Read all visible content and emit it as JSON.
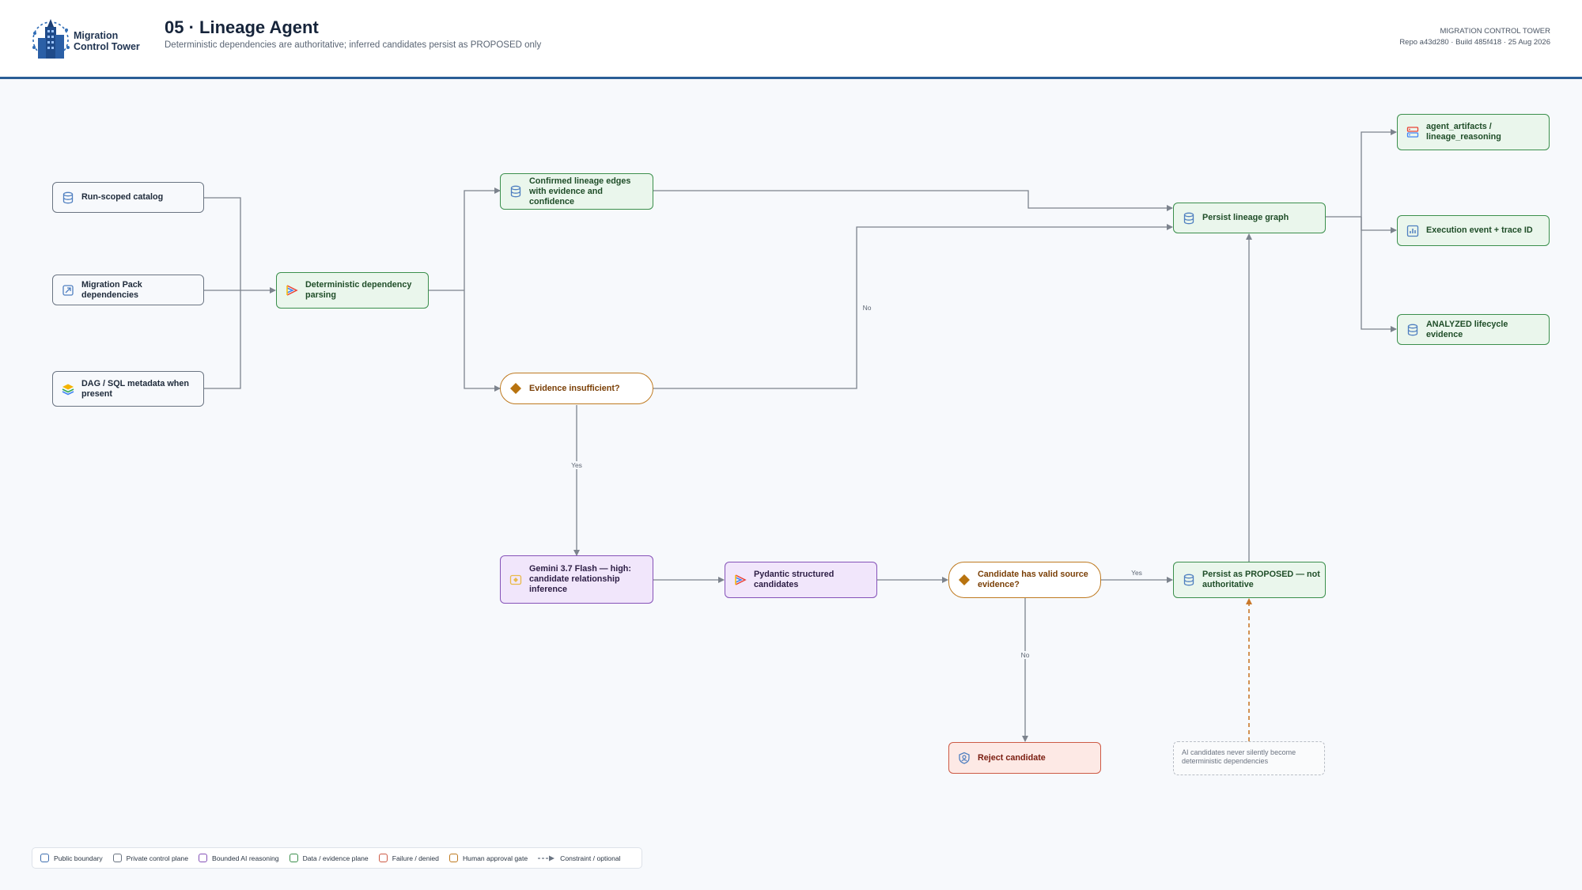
{
  "header": {
    "brand_line1": "Migration",
    "brand_line2": "Control Tower",
    "title": "05 · Lineage Agent",
    "subtitle": "Deterministic dependencies are authoritative; inferred candidates persist as PROPOSED only",
    "tower_label": "MIGRATION CONTROL TOWER",
    "build_meta": "Repo a43d280 · Build 485f418 · 25 Aug 2026"
  },
  "nodes": {
    "run_catalog": "Run-scoped catalog",
    "pack_deps": "Migration Pack dependencies",
    "dag_sql": "DAG / SQL metadata when present",
    "det_parsing": "Deterministic dependency parsing",
    "confirmed_edges": "Confirmed lineage edges with evidence and confidence",
    "evidence_insufficient": "Evidence insufficient?",
    "gemini": "Gemini 3.7 Flash — high: candidate relationship inference",
    "pydantic": "Pydantic structured candidates",
    "valid_source": "Candidate has valid source evidence?",
    "persist_proposed": "Persist as PROPOSED — not authoritative",
    "reject": "Reject candidate",
    "persist_graph": "Persist lineage graph",
    "artifacts": "agent_artifacts / lineage_reasoning",
    "exec_event": "Execution event + trace ID",
    "analyzed": "ANALYZED lifecycle evidence"
  },
  "note": "AI candidates never silently become deterministic dependencies",
  "edge_labels": {
    "no_top": "No",
    "yes_mid": "Yes",
    "yes_right": "Yes",
    "no_bottom": "No"
  },
  "legend": [
    {
      "label": "Public boundary",
      "color": "#3f6fb0"
    },
    {
      "label": "Private control plane",
      "color": "#6a7482"
    },
    {
      "label": "Bounded AI reasoning",
      "color": "#8552b8"
    },
    {
      "label": "Data / evidence plane",
      "color": "#3b8f4c"
    },
    {
      "label": "Failure / denied",
      "color": "#cd5a45"
    },
    {
      "label": "Human approval gate",
      "color": "#bf7a20"
    },
    {
      "label": "Constraint / optional",
      "color": "#6a7482"
    }
  ]
}
